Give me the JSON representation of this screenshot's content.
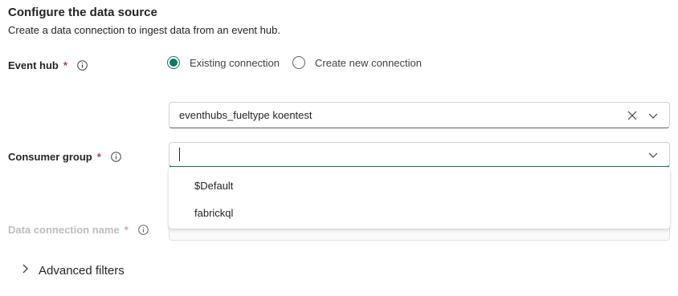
{
  "header": {
    "title": "Configure the data source",
    "subtitle": "Create a data connection to ingest data from an event hub."
  },
  "event_hub": {
    "label": "Event hub",
    "required_mark": "*",
    "options": [
      {
        "label": "Existing connection",
        "selected": true
      },
      {
        "label": "Create new connection",
        "selected": false
      }
    ],
    "value": "eventhubs_fueltype koentest"
  },
  "consumer_group": {
    "label": "Consumer group",
    "required_mark": "*",
    "value": "",
    "dropdown_options": [
      "$Default",
      "fabrickql"
    ]
  },
  "data_connection": {
    "label": "Data connection name",
    "required_mark": "*"
  },
  "advanced": {
    "label": "Advanced filters"
  },
  "colors": {
    "accent": "#117865",
    "required": "#c4314b",
    "disabled_text": "#bdbdbd"
  },
  "icons": [
    "info-icon",
    "close-icon",
    "chevron-down-icon",
    "chevron-right-icon"
  ]
}
